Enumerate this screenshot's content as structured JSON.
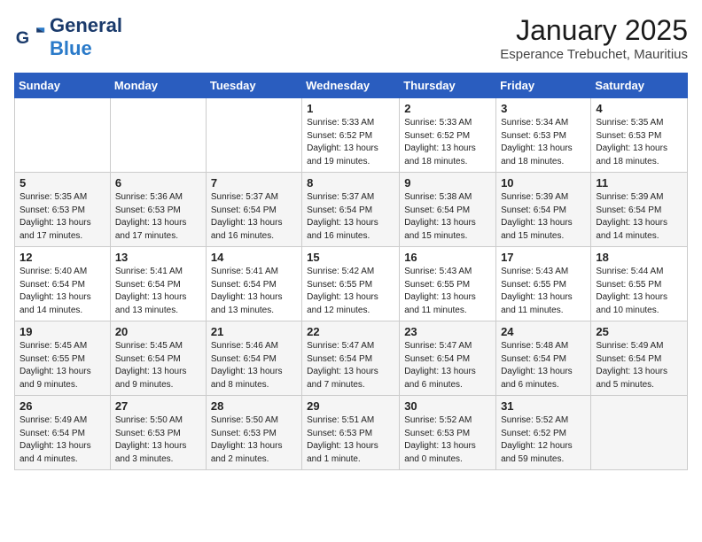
{
  "header": {
    "logo_general": "General",
    "logo_blue": "Blue",
    "month_title": "January 2025",
    "location": "Esperance Trebuchet, Mauritius"
  },
  "weekdays": [
    "Sunday",
    "Monday",
    "Tuesday",
    "Wednesday",
    "Thursday",
    "Friday",
    "Saturday"
  ],
  "weeks": [
    [
      {
        "day": "",
        "info": ""
      },
      {
        "day": "",
        "info": ""
      },
      {
        "day": "",
        "info": ""
      },
      {
        "day": "1",
        "info": "Sunrise: 5:33 AM\nSunset: 6:52 PM\nDaylight: 13 hours\nand 19 minutes."
      },
      {
        "day": "2",
        "info": "Sunrise: 5:33 AM\nSunset: 6:52 PM\nDaylight: 13 hours\nand 18 minutes."
      },
      {
        "day": "3",
        "info": "Sunrise: 5:34 AM\nSunset: 6:53 PM\nDaylight: 13 hours\nand 18 minutes."
      },
      {
        "day": "4",
        "info": "Sunrise: 5:35 AM\nSunset: 6:53 PM\nDaylight: 13 hours\nand 18 minutes."
      }
    ],
    [
      {
        "day": "5",
        "info": "Sunrise: 5:35 AM\nSunset: 6:53 PM\nDaylight: 13 hours\nand 17 minutes."
      },
      {
        "day": "6",
        "info": "Sunrise: 5:36 AM\nSunset: 6:53 PM\nDaylight: 13 hours\nand 17 minutes."
      },
      {
        "day": "7",
        "info": "Sunrise: 5:37 AM\nSunset: 6:54 PM\nDaylight: 13 hours\nand 16 minutes."
      },
      {
        "day": "8",
        "info": "Sunrise: 5:37 AM\nSunset: 6:54 PM\nDaylight: 13 hours\nand 16 minutes."
      },
      {
        "day": "9",
        "info": "Sunrise: 5:38 AM\nSunset: 6:54 PM\nDaylight: 13 hours\nand 15 minutes."
      },
      {
        "day": "10",
        "info": "Sunrise: 5:39 AM\nSunset: 6:54 PM\nDaylight: 13 hours\nand 15 minutes."
      },
      {
        "day": "11",
        "info": "Sunrise: 5:39 AM\nSunset: 6:54 PM\nDaylight: 13 hours\nand 14 minutes."
      }
    ],
    [
      {
        "day": "12",
        "info": "Sunrise: 5:40 AM\nSunset: 6:54 PM\nDaylight: 13 hours\nand 14 minutes."
      },
      {
        "day": "13",
        "info": "Sunrise: 5:41 AM\nSunset: 6:54 PM\nDaylight: 13 hours\nand 13 minutes."
      },
      {
        "day": "14",
        "info": "Sunrise: 5:41 AM\nSunset: 6:54 PM\nDaylight: 13 hours\nand 13 minutes."
      },
      {
        "day": "15",
        "info": "Sunrise: 5:42 AM\nSunset: 6:55 PM\nDaylight: 13 hours\nand 12 minutes."
      },
      {
        "day": "16",
        "info": "Sunrise: 5:43 AM\nSunset: 6:55 PM\nDaylight: 13 hours\nand 11 minutes."
      },
      {
        "day": "17",
        "info": "Sunrise: 5:43 AM\nSunset: 6:55 PM\nDaylight: 13 hours\nand 11 minutes."
      },
      {
        "day": "18",
        "info": "Sunrise: 5:44 AM\nSunset: 6:55 PM\nDaylight: 13 hours\nand 10 minutes."
      }
    ],
    [
      {
        "day": "19",
        "info": "Sunrise: 5:45 AM\nSunset: 6:55 PM\nDaylight: 13 hours\nand 9 minutes."
      },
      {
        "day": "20",
        "info": "Sunrise: 5:45 AM\nSunset: 6:54 PM\nDaylight: 13 hours\nand 9 minutes."
      },
      {
        "day": "21",
        "info": "Sunrise: 5:46 AM\nSunset: 6:54 PM\nDaylight: 13 hours\nand 8 minutes."
      },
      {
        "day": "22",
        "info": "Sunrise: 5:47 AM\nSunset: 6:54 PM\nDaylight: 13 hours\nand 7 minutes."
      },
      {
        "day": "23",
        "info": "Sunrise: 5:47 AM\nSunset: 6:54 PM\nDaylight: 13 hours\nand 6 minutes."
      },
      {
        "day": "24",
        "info": "Sunrise: 5:48 AM\nSunset: 6:54 PM\nDaylight: 13 hours\nand 6 minutes."
      },
      {
        "day": "25",
        "info": "Sunrise: 5:49 AM\nSunset: 6:54 PM\nDaylight: 13 hours\nand 5 minutes."
      }
    ],
    [
      {
        "day": "26",
        "info": "Sunrise: 5:49 AM\nSunset: 6:54 PM\nDaylight: 13 hours\nand 4 minutes."
      },
      {
        "day": "27",
        "info": "Sunrise: 5:50 AM\nSunset: 6:53 PM\nDaylight: 13 hours\nand 3 minutes."
      },
      {
        "day": "28",
        "info": "Sunrise: 5:50 AM\nSunset: 6:53 PM\nDaylight: 13 hours\nand 2 minutes."
      },
      {
        "day": "29",
        "info": "Sunrise: 5:51 AM\nSunset: 6:53 PM\nDaylight: 13 hours\nand 1 minute."
      },
      {
        "day": "30",
        "info": "Sunrise: 5:52 AM\nSunset: 6:53 PM\nDaylight: 13 hours\nand 0 minutes."
      },
      {
        "day": "31",
        "info": "Sunrise: 5:52 AM\nSunset: 6:52 PM\nDaylight: 12 hours\nand 59 minutes."
      },
      {
        "day": "",
        "info": ""
      }
    ]
  ]
}
